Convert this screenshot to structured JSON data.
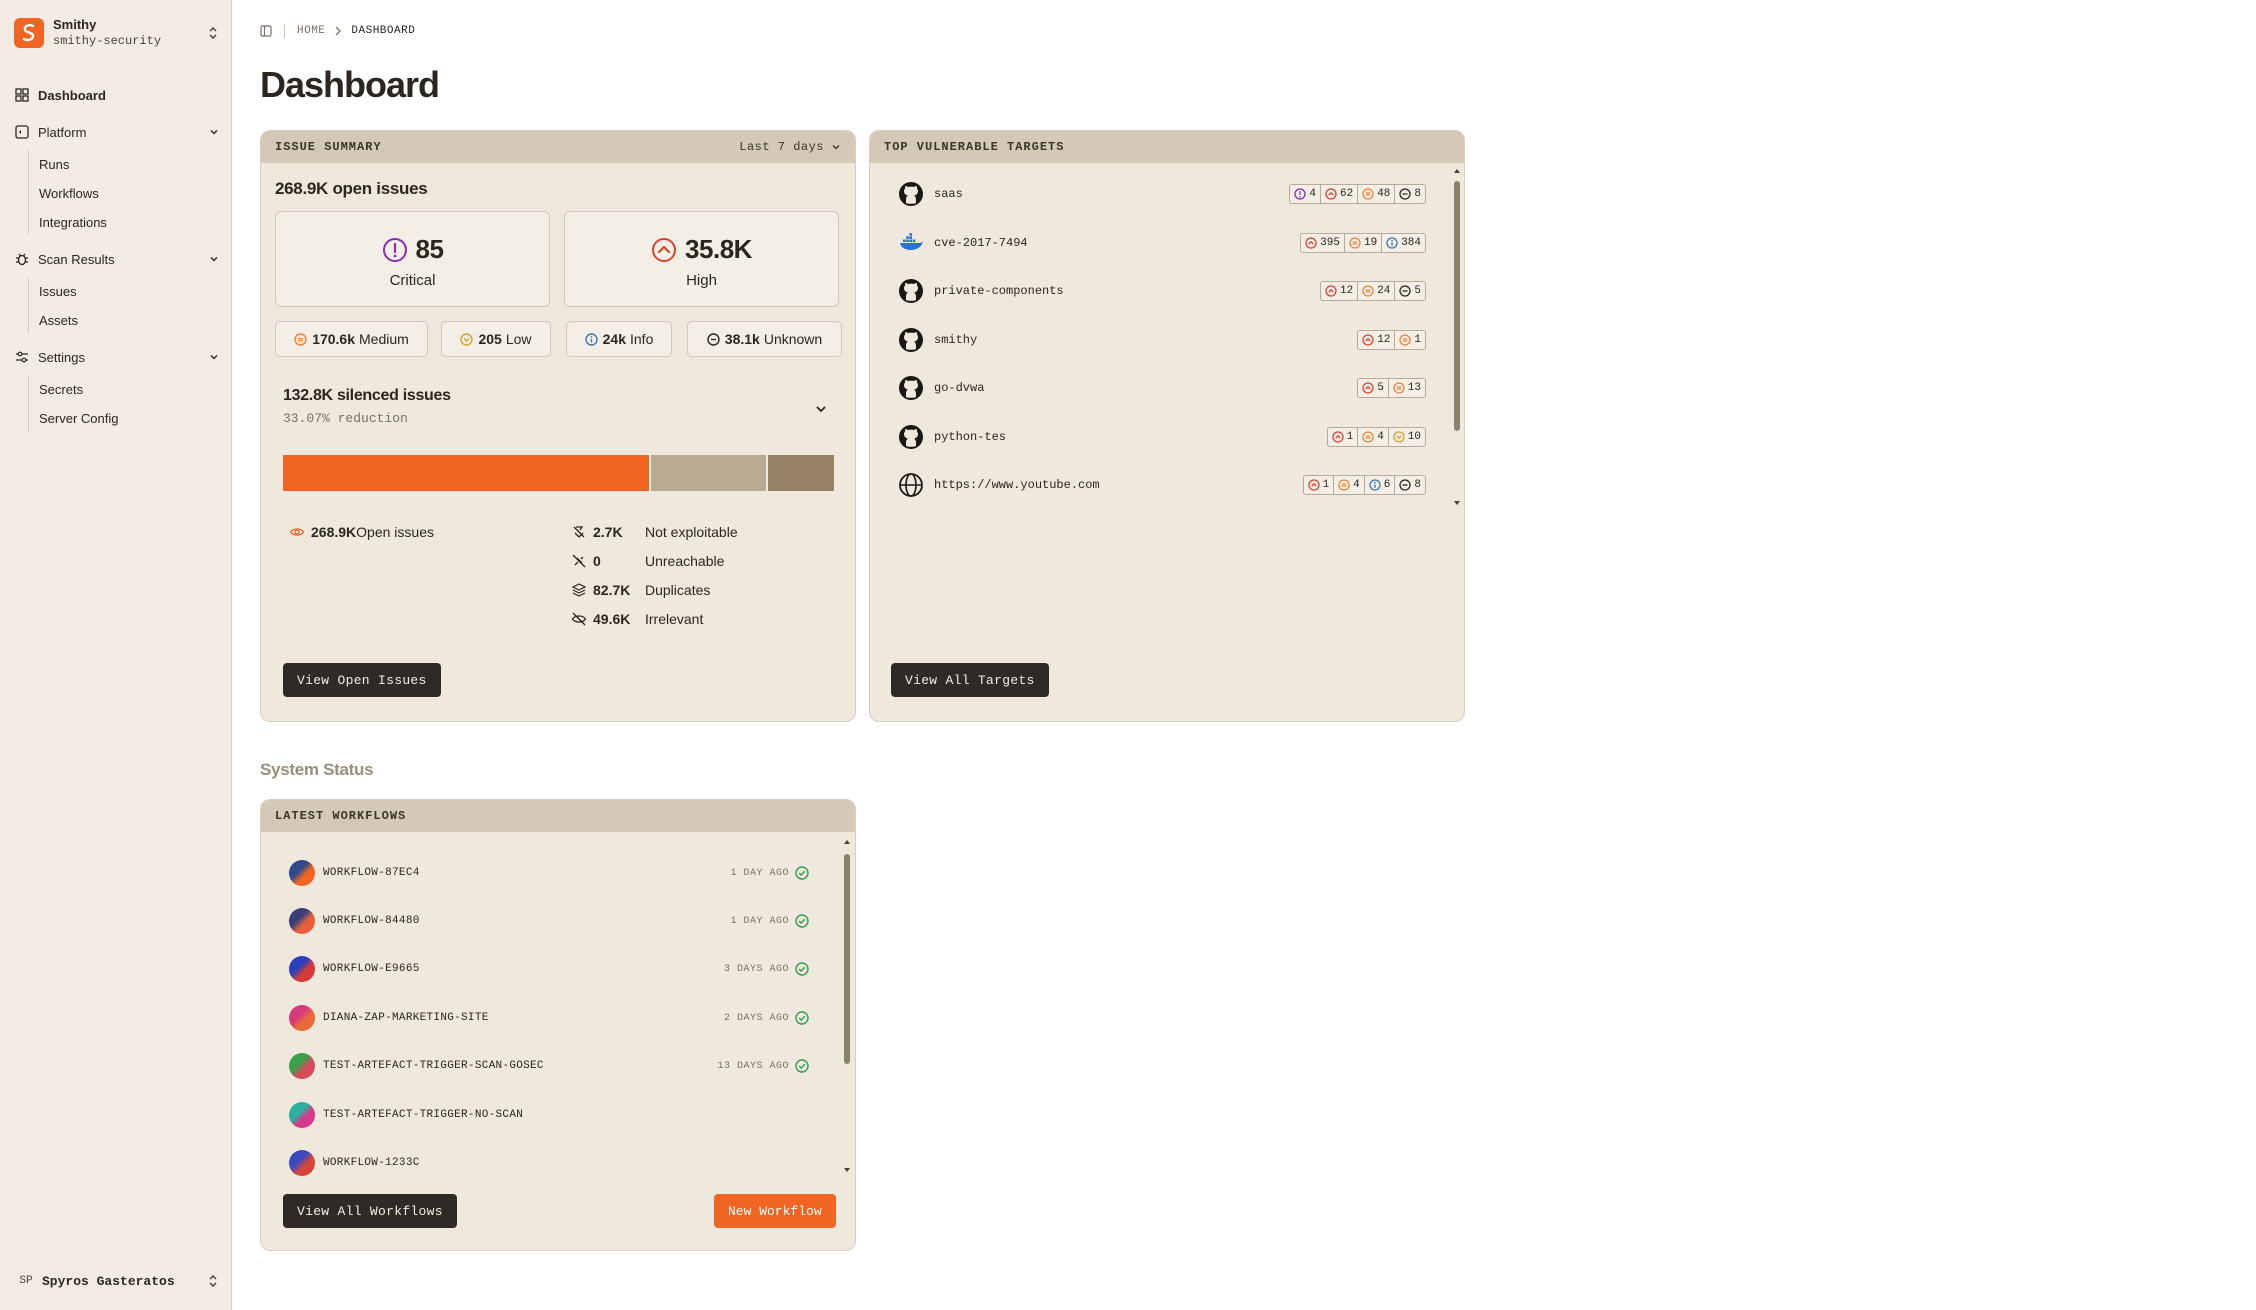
{
  "org": {
    "name": "Smithy",
    "slug": "smithy-security"
  },
  "nav": {
    "dashboard": "Dashboard",
    "platform": {
      "label": "Platform",
      "items": [
        "Runs",
        "Workflows",
        "Integrations"
      ]
    },
    "scan_results": {
      "label": "Scan Results",
      "items": [
        "Issues",
        "Assets"
      ]
    },
    "settings": {
      "label": "Settings",
      "items": [
        "Secrets",
        "Server Config"
      ]
    }
  },
  "user": {
    "initials": "SP",
    "name": "Spyros Gasteratos"
  },
  "breadcrumb": {
    "home": "HOME",
    "current": "DASHBOARD"
  },
  "page_title": "Dashboard",
  "issue_summary": {
    "title": "ISSUE SUMMARY",
    "range": "Last 7 days",
    "open_issues": "268.9K open issues",
    "critical": {
      "value": "85",
      "label": "Critical"
    },
    "high": {
      "value": "35.8K",
      "label": "High"
    },
    "medium": {
      "value": "170.6k",
      "label": "Medium"
    },
    "low": {
      "value": "205",
      "label": "Low"
    },
    "info": {
      "value": "24k",
      "label": "Info"
    },
    "unknown": {
      "value": "38.1k",
      "label": "Unknown"
    },
    "silenced_title": "132.8K silenced issues",
    "silenced_sub": "33.07% reduction",
    "bar_fractions": {
      "open": 0.669,
      "silenced_a": 0.21,
      "silenced_b": 0.121
    },
    "open_value": "268.9K",
    "open_label": "Open issues",
    "not_exploitable": {
      "value": "2.7K",
      "label": "Not exploitable"
    },
    "unreachable": {
      "value": "0",
      "label": "Unreachable"
    },
    "duplicates": {
      "value": "82.7K",
      "label": "Duplicates"
    },
    "irrelevant": {
      "value": "49.6K",
      "label": "Irrelevant"
    },
    "button": "View Open Issues"
  },
  "targets": {
    "title": "TOP VULNERABLE TARGETS",
    "items": [
      {
        "name": "saas",
        "icon": "github-icon",
        "b": [
          "4",
          "62",
          "48",
          "8"
        ]
      },
      {
        "name": "cve-2017-7494",
        "icon": "docker-icon",
        "b": [
          "395",
          "19",
          "384"
        ]
      },
      {
        "name": "private-components",
        "icon": "github-icon",
        "b": [
          "12",
          "24",
          "5"
        ]
      },
      {
        "name": "smithy",
        "icon": "github-icon",
        "b": [
          "12",
          "1"
        ]
      },
      {
        "name": "go-dvwa",
        "icon": "github-icon",
        "b": [
          "5",
          "13"
        ]
      },
      {
        "name": "python-tes",
        "icon": "github-icon",
        "b": [
          "1",
          "4",
          "10"
        ]
      },
      {
        "name": "https://www.youtube.com",
        "icon": "globe-icon",
        "b": [
          "1",
          "4",
          "6",
          "8"
        ]
      }
    ],
    "button": "View All Targets"
  },
  "system_status": "System Status",
  "workflows": {
    "title": "LATEST WORKFLOWS",
    "items": [
      {
        "name": "WORKFLOW-87EC4",
        "time": "1 DAY AGO"
      },
      {
        "name": "WORKFLOW-84480",
        "time": "1 DAY AGO"
      },
      {
        "name": "WORKFLOW-E9665",
        "time": "3 DAYS AGO"
      },
      {
        "name": "DIANA-ZAP-MARKETING-SITE",
        "time": "2 DAYS AGO"
      },
      {
        "name": "TEST-ARTEFACT-TRIGGER-SCAN-GOSEC",
        "time": "13 DAYS AGO"
      },
      {
        "name": "TEST-ARTEFACT-TRIGGER-NO-SCAN",
        "time": ""
      },
      {
        "name": "WORKFLOW-1233C",
        "time": ""
      }
    ],
    "view_all": "View All Workflows",
    "new": "New Workflow"
  },
  "colors": {
    "accent": "#f26422",
    "critical": "#8a2bb5",
    "high": "#d6452b",
    "medium": "#e8843a",
    "low": "#d9a02c",
    "info": "#3a7ab0",
    "success": "#2e9e4a"
  }
}
